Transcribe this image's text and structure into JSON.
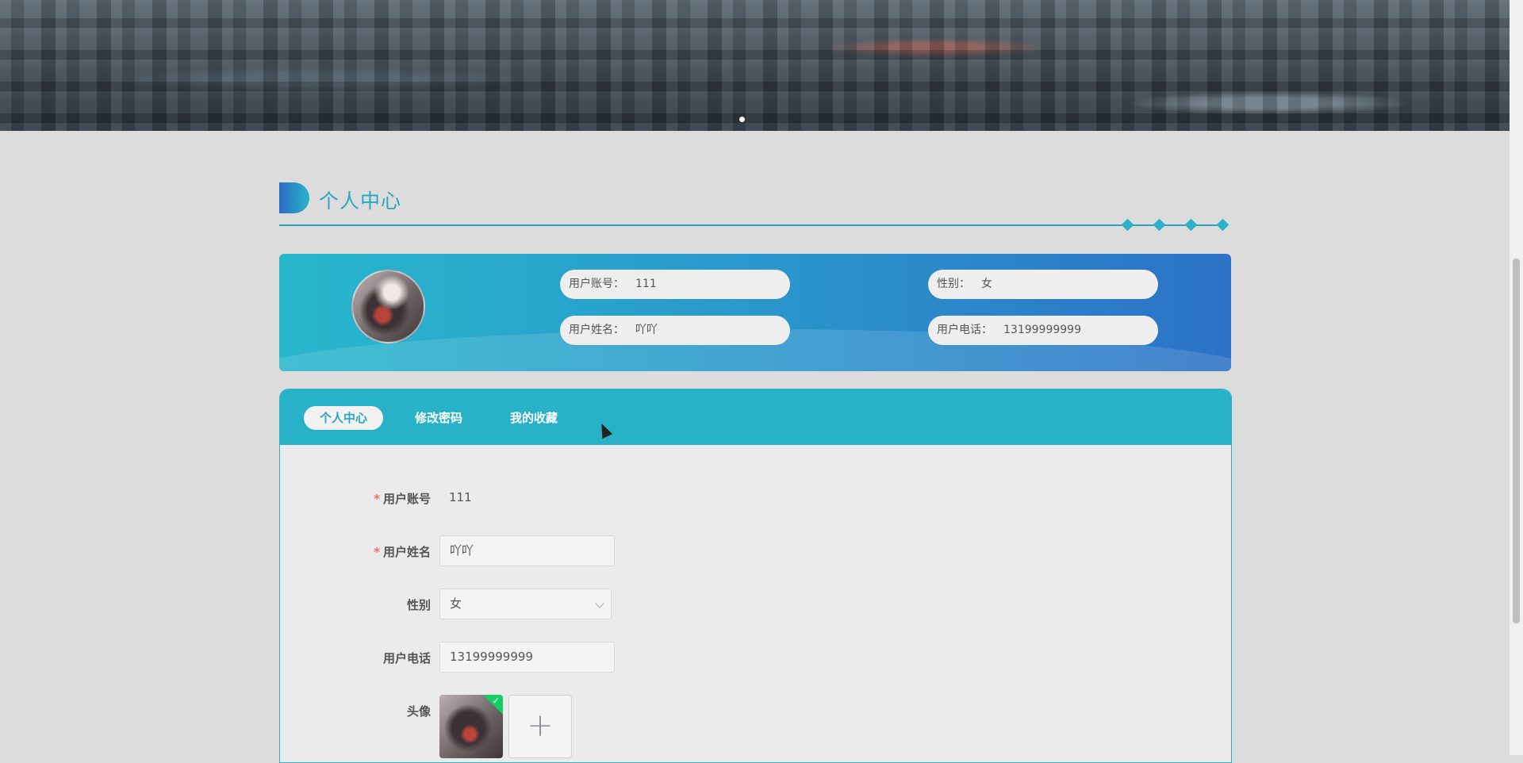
{
  "section": {
    "title": "个人中心"
  },
  "info_card": {
    "account_label": "用户账号：",
    "account_value": "111",
    "name_label": "用户姓名：",
    "name_value": "吖吖",
    "gender_label": "性别：",
    "gender_value": "女",
    "phone_label": "用户电话：",
    "phone_value": "13199999999"
  },
  "tabs": [
    {
      "label": "个人中心",
      "active": true
    },
    {
      "label": "修改密码",
      "active": false
    },
    {
      "label": "我的收藏",
      "active": false
    }
  ],
  "form": {
    "account_label": "用户账号",
    "account_value": "111",
    "name_label": "用户姓名",
    "name_value": "吖吖",
    "gender_label": "性别",
    "gender_value": "女",
    "phone_label": "用户电话",
    "phone_value": "13199999999",
    "avatar_label": "头像",
    "upload_symbol": "+"
  },
  "colors": {
    "accent": "#2aa6c4",
    "tabbar": "#28b2c8",
    "required": "#f56c6c",
    "success": "#13ce66"
  },
  "icons": [
    "carousel-dot-icon",
    "chevron-down-icon",
    "check-icon",
    "plus-icon",
    "cursor-icon"
  ]
}
